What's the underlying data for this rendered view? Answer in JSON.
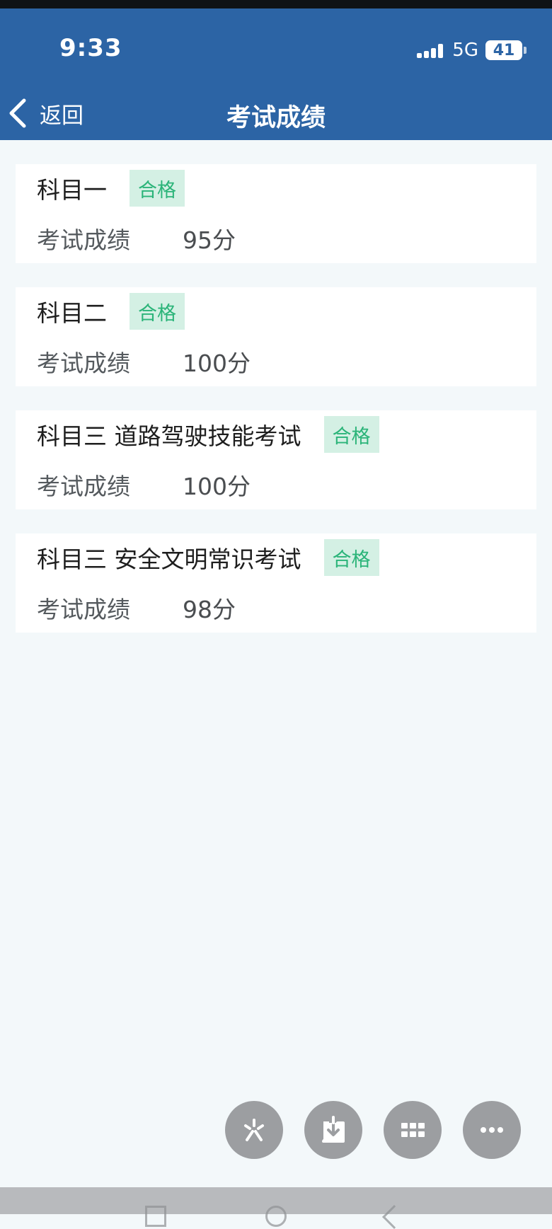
{
  "status_bar": {
    "time": "9:33",
    "network": "5G",
    "battery": "41"
  },
  "nav": {
    "back_label": "返回",
    "title": "考试成绩"
  },
  "results": [
    {
      "subject": "科目一",
      "status": "合格",
      "score_label": "考试成绩",
      "score": "95分"
    },
    {
      "subject": "科目二",
      "status": "合格",
      "score_label": "考试成绩",
      "score": "100分"
    },
    {
      "subject": "科目三 道路驾驶技能考试",
      "status": "合格",
      "score_label": "考试成绩",
      "score": "100分"
    },
    {
      "subject": "科目三 安全文明常识考试",
      "status": "合格",
      "score_label": "考试成绩",
      "score": "98分"
    }
  ],
  "floating_buttons": [
    {
      "icon": "sparkle-icon"
    },
    {
      "icon": "download-icon"
    },
    {
      "icon": "grid-icon"
    },
    {
      "icon": "more-icon"
    }
  ],
  "colors": {
    "header": "#2c64a5",
    "pass_badge_bg": "#d4f0e4",
    "pass_badge_text": "#2bb479",
    "page_bg": "#f3f8fa"
  }
}
